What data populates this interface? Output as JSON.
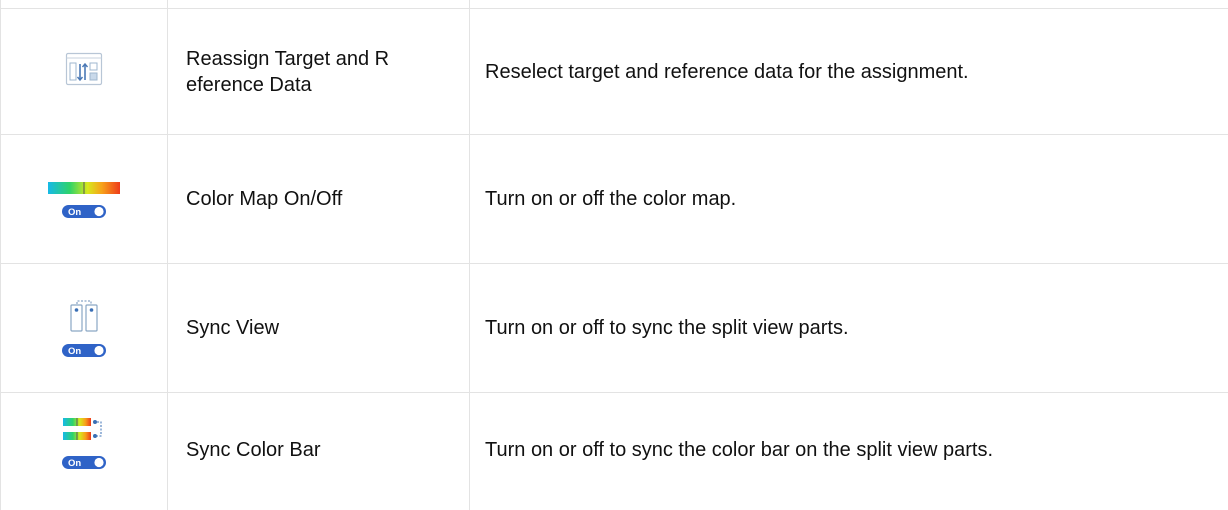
{
  "rows": [
    {
      "icon": "reassign-data-icon",
      "name": "Reassign Target and Reference Data",
      "name_line1": "Reassign Target and R",
      "name_line2": "eference Data",
      "description": "Reselect target and reference data for the assignment."
    },
    {
      "icon": "color-map-icon",
      "name": "Color Map On/Off",
      "toggle": "On",
      "description": "Turn on or off the color map."
    },
    {
      "icon": "sync-view-icon",
      "name": "Sync View",
      "toggle": "On",
      "description": "Turn on or off to sync the split view parts."
    },
    {
      "icon": "sync-color-bar-icon",
      "name": "Sync Color Bar",
      "toggle": "On",
      "description": "Turn on or off to sync the color bar on the split view parts."
    }
  ],
  "colors": {
    "grid": "#e3e3e3",
    "toggle_fill": "#2f63c7",
    "icon_outline": "#9fb7cf"
  }
}
